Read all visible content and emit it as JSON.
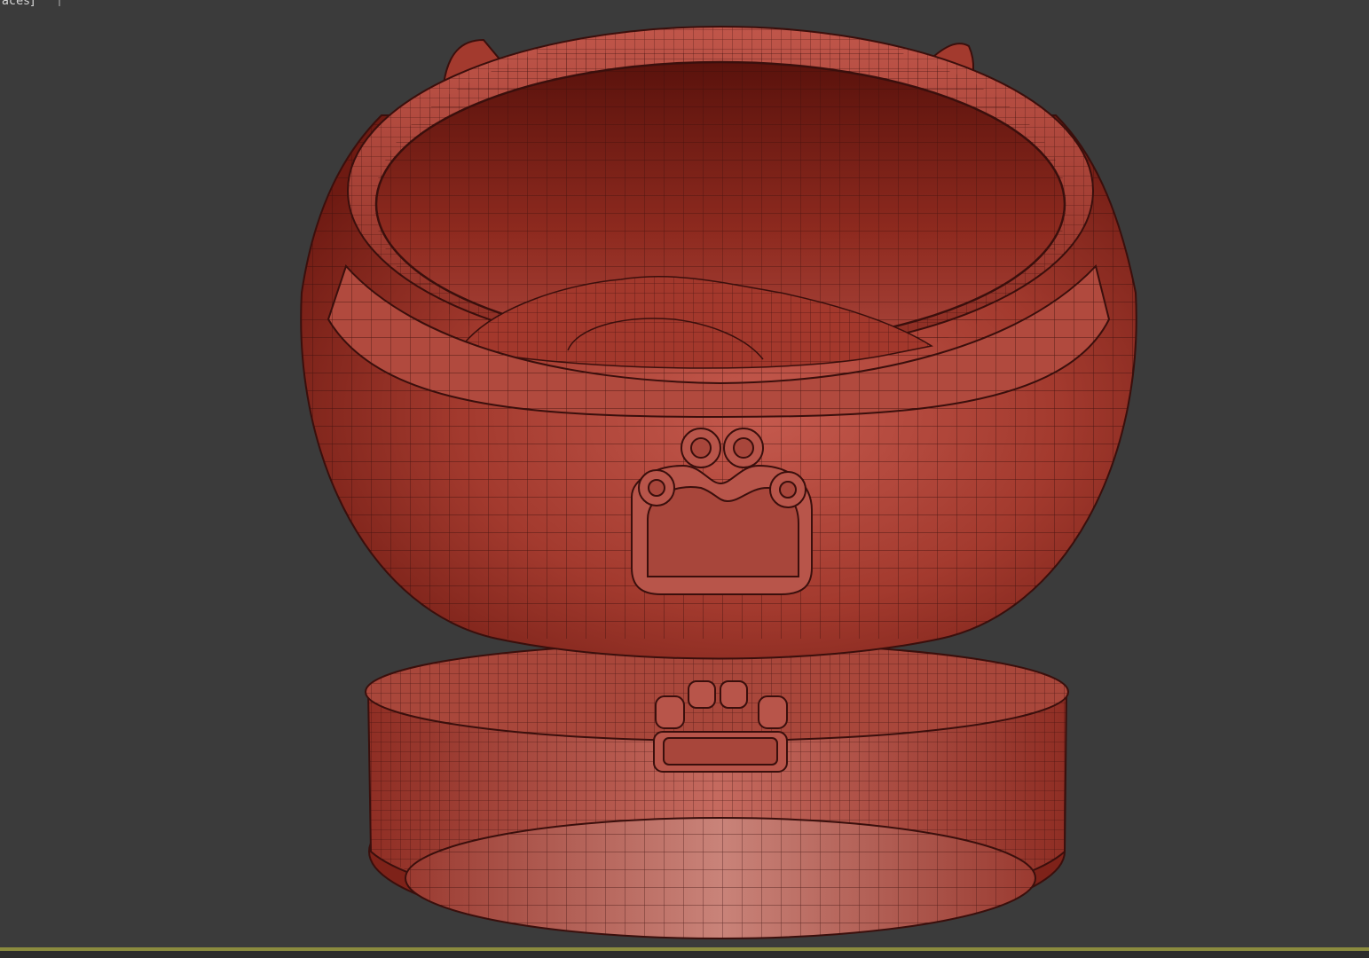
{
  "viewport": {
    "label": "aces]",
    "background": "#3b3b3b",
    "border_color": "#8b8b3e"
  },
  "model": {
    "description_icon": "wireframe-pet-bed-model",
    "surface_color": "#b8473b",
    "wire_color": "#3a0f0c",
    "emblem_icon": "paw-print-icon"
  }
}
